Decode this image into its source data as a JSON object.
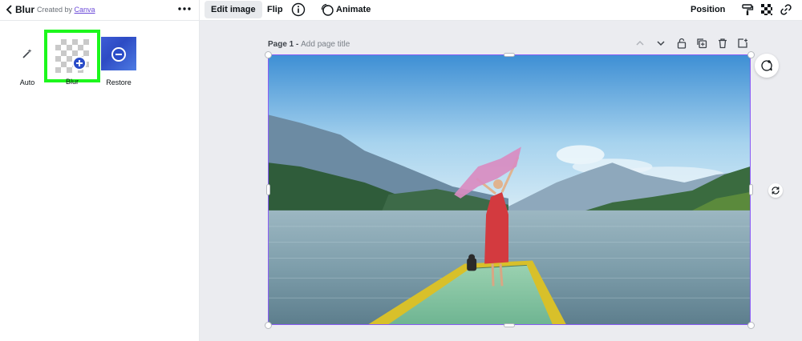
{
  "panel": {
    "title": "Blur",
    "created_by_prefix": "Created by",
    "created_by_link": "Canva",
    "tools": [
      {
        "label": "Auto",
        "icon": "magic-wand-icon"
      },
      {
        "label": "Blur",
        "icon": "plus-circle-icon",
        "selected": true
      },
      {
        "label": "Restore",
        "icon": "minus-circle-icon"
      }
    ]
  },
  "toolbar": {
    "edit_image": "Edit image",
    "flip": "Flip",
    "animate": "Animate",
    "position": "Position"
  },
  "page": {
    "label": "Page 1 -",
    "title_placeholder": "Add page title"
  },
  "colors": {
    "accent": "#8a5cf6",
    "highlight": "#1cf71c",
    "link": "#6b4ad8",
    "canvas_bg": "#ebecf0"
  }
}
